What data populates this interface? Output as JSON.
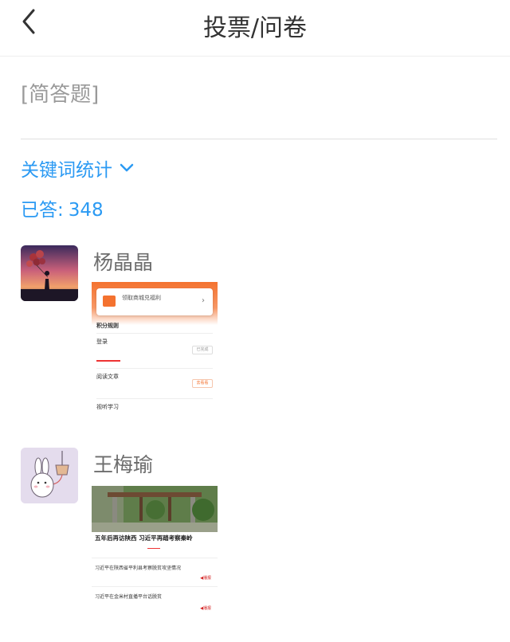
{
  "header": {
    "title": "投票/问卷"
  },
  "question": {
    "type_label": "[简答题]"
  },
  "stats": {
    "keyword_toggle_label": "关键词统计",
    "answered_label": "已答:",
    "answered_count": "348"
  },
  "responses": [
    {
      "name": "杨晶晶",
      "thumb": {
        "card_title": "领取商城兑福利",
        "section": "积分规则",
        "rows": [
          "登录",
          "阅读文章",
          "视听学习"
        ],
        "btn_done": "已完成",
        "btn_go": "去看看"
      }
    },
    {
      "name": "王梅瑜",
      "thumb": {
        "caption": "五年后再访陕西 习近平再踏考察秦岭",
        "items": [
          {
            "title": "习近平在陕西省平利县考察脱贫攻坚情况",
            "play": "◀播报"
          },
          {
            "title": "习近平在金米村直播平台话脱贫",
            "play": "◀播报"
          }
        ]
      }
    }
  ],
  "colors": {
    "accent": "#2b9af3",
    "orange": "#f4722f",
    "text": "#333333"
  }
}
